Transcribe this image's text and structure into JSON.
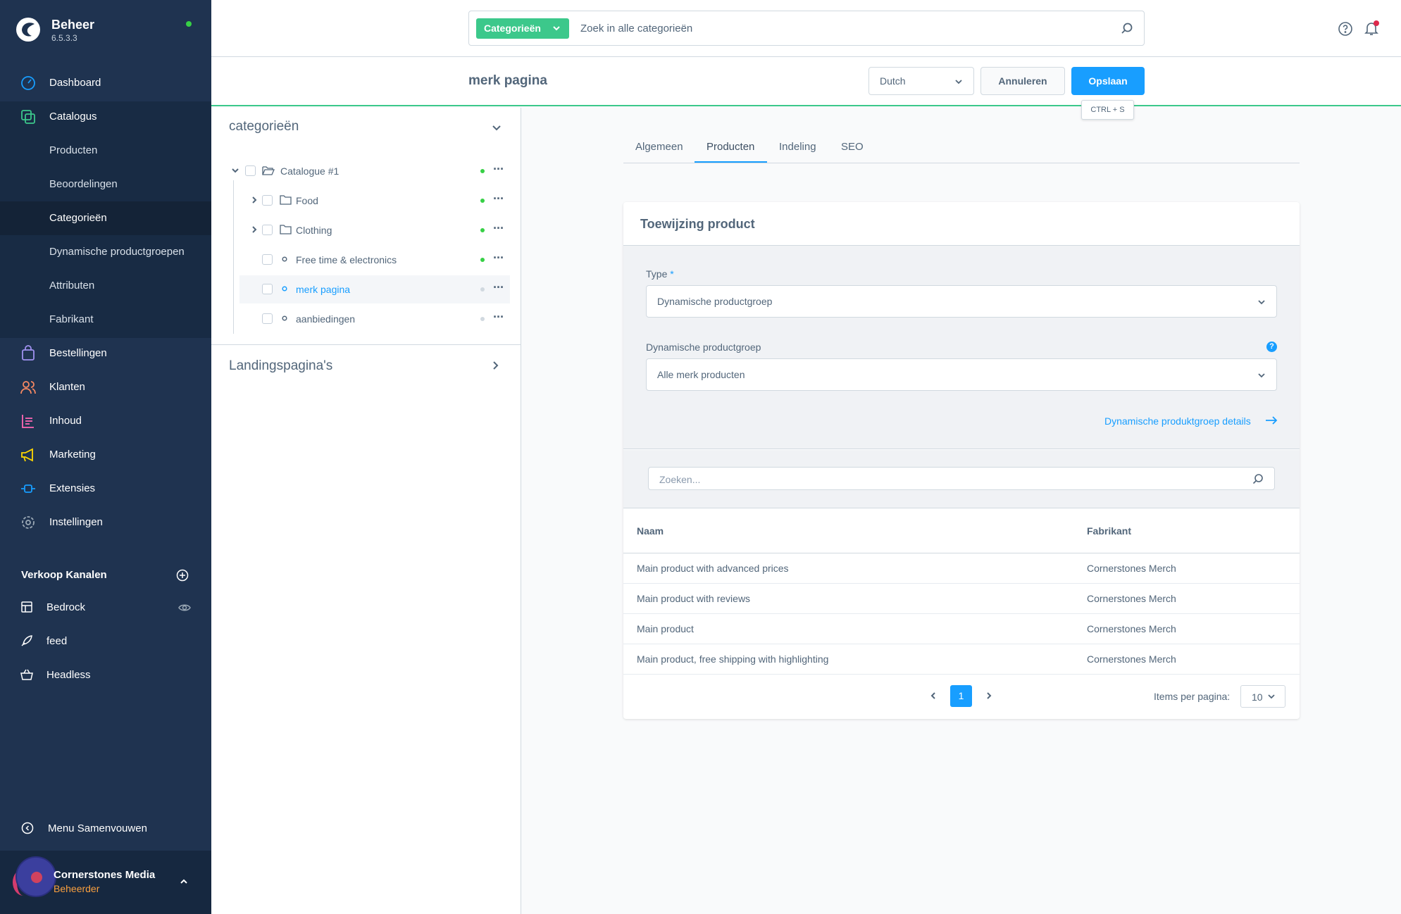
{
  "app": {
    "title": "Beheer",
    "version": "6.5.3.3"
  },
  "nav": {
    "dashboard": "Dashboard",
    "catalogus": "Catalogus",
    "catalog_sub": [
      "Producten",
      "Beoordelingen",
      "Categorieën",
      "Dynamische productgroepen",
      "Attributen",
      "Fabrikant"
    ],
    "bestellingen": "Bestellingen",
    "klanten": "Klanten",
    "inhoud": "Inhoud",
    "marketing": "Marketing",
    "extensies": "Extensies",
    "instellingen": "Instellingen"
  },
  "channels": {
    "title": "Verkoop Kanalen",
    "items": [
      "Bedrock",
      "feed",
      "Headless"
    ]
  },
  "collapse_label": "Menu Samenvouwen",
  "user": {
    "name": "Cornerstones Media",
    "role": "Beheerder"
  },
  "search": {
    "type_label": "Categorieën",
    "placeholder": "Zoek in alle categorieën"
  },
  "smartbar": {
    "title": "merk pagina",
    "language": "Dutch",
    "cancel": "Annuleren",
    "save": "Opslaan",
    "save_shortcut": "CTRL + S"
  },
  "tree": {
    "title": "categorieën",
    "items": [
      {
        "label": "Catalogue #1",
        "active": true
      },
      {
        "label": "Food",
        "active": true
      },
      {
        "label": "Clothing",
        "active": true
      },
      {
        "label": "Free time & electronics",
        "active": true
      },
      {
        "label": "merk pagina",
        "active": false
      },
      {
        "label": "aanbiedingen",
        "active": false
      }
    ],
    "landing_title": "Landingspagina's"
  },
  "tabs": [
    "Algemeen",
    "Producten",
    "Indeling",
    "SEO"
  ],
  "active_tab": "Producten",
  "assignment": {
    "title": "Toewijzing product",
    "type_label": "Type",
    "required_mark": "*",
    "type_value": "Dynamische productgroep",
    "group_label": "Dynamische productgroep",
    "help_mark": "?",
    "group_value": "Alle merk producten",
    "details_link": "Dynamische produktgroep details"
  },
  "table": {
    "search_placeholder": "Zoeken...",
    "columns": [
      "Naam",
      "Fabrikant"
    ],
    "rows": [
      [
        "Main product with advanced prices",
        "Cornerstones Merch"
      ],
      [
        "Main product with reviews",
        "Cornerstones Merch"
      ],
      [
        "Main product",
        "Cornerstones Merch"
      ],
      [
        "Main product, free shipping with highlighting",
        "Cornerstones Merch"
      ]
    ]
  },
  "pagination": {
    "current_page": "1",
    "items_per_page_label": "Items per pagina:",
    "items_per_page": "10"
  },
  "colors": {
    "sidebar_bg": "#1f3350",
    "accent": "#189eff",
    "green": "#3cc88b",
    "status_active": "#37d046"
  }
}
